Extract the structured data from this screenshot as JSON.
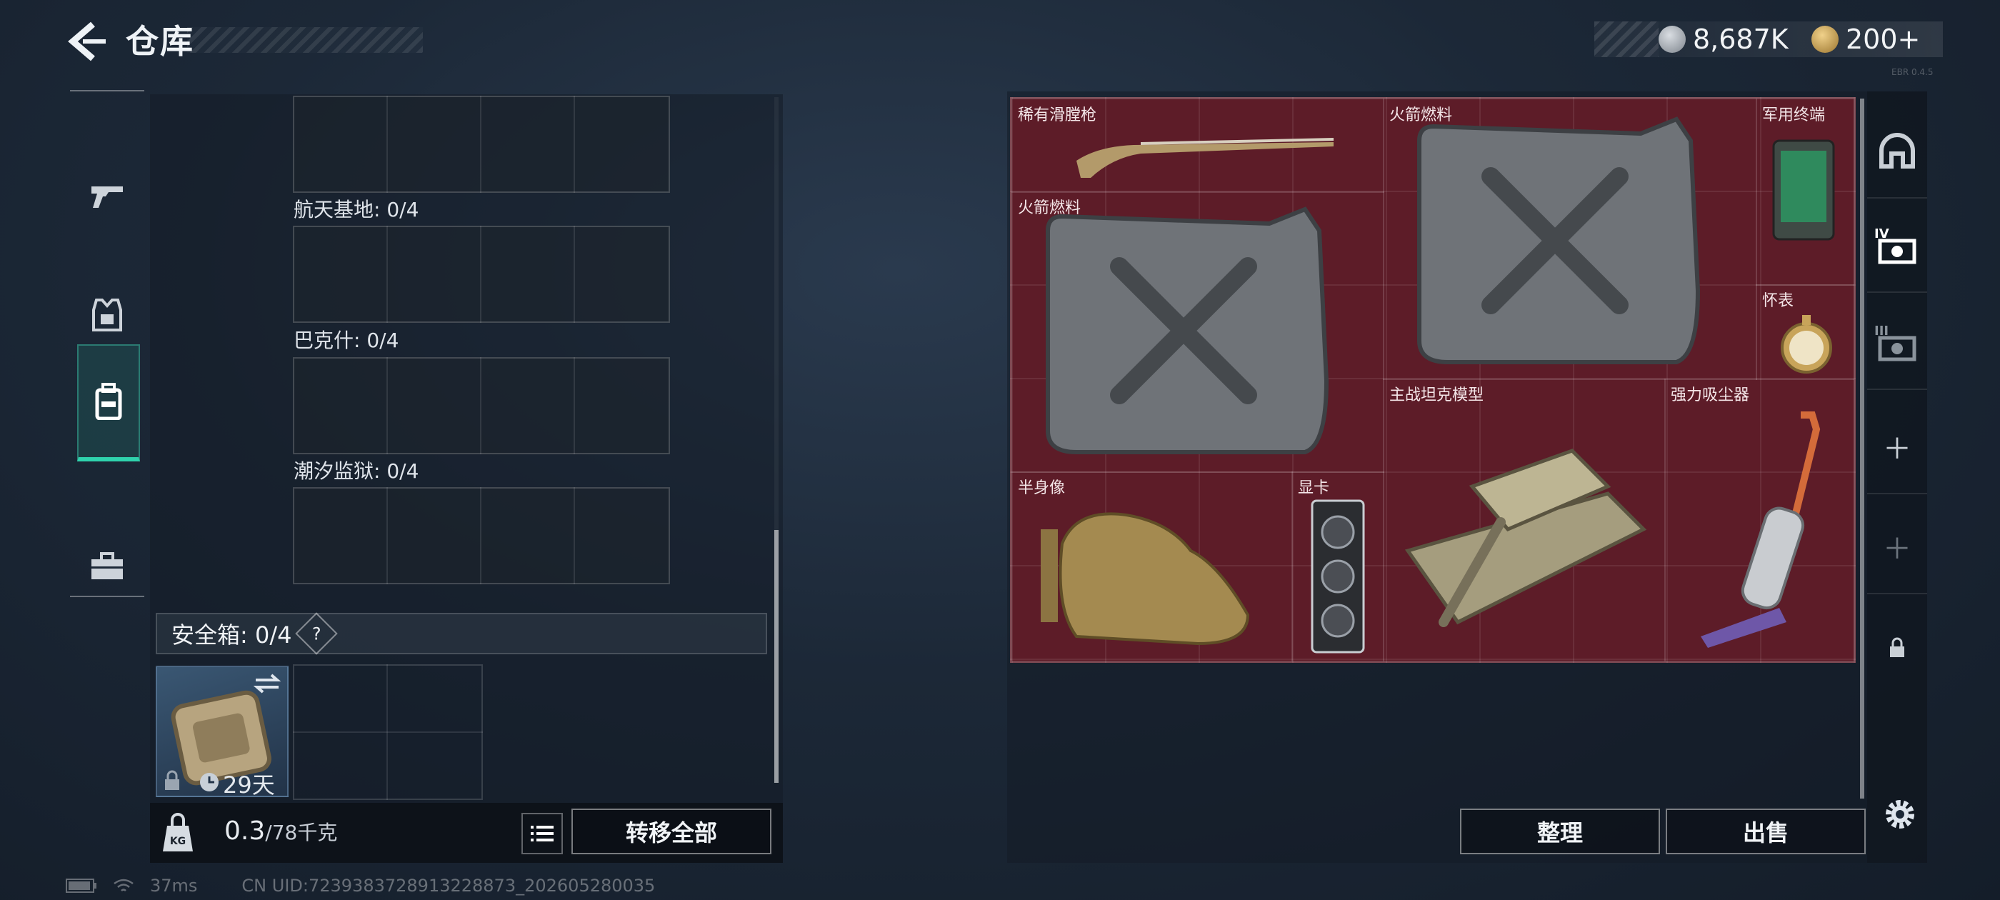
{
  "header": {
    "title": "仓库"
  },
  "currency": {
    "silver": "8,687K",
    "gold": "200+"
  },
  "version_text": "EBR 0.4.5",
  "left_panel": {
    "slots": [
      {
        "label": ""
      },
      {
        "label": "航天基地: 0/4"
      },
      {
        "label": "巴克什: 0/4"
      },
      {
        "label": "潮汐监狱: 0/4"
      }
    ],
    "safe_box": {
      "label": "安全箱: 0/4",
      "help": "?",
      "timer": "29天"
    },
    "weight": {
      "current": "0.3",
      "capacity": "/78千克"
    },
    "transfer_all_label": "转移全部"
  },
  "stash_items": [
    {
      "id": "musket",
      "label": "稀有滑膛枪"
    },
    {
      "id": "fuel1",
      "label": "火箭燃料"
    },
    {
      "id": "terminal",
      "label": "军用终端"
    },
    {
      "id": "fuel2",
      "label": "火箭燃料"
    },
    {
      "id": "pocketwatch",
      "label": "怀表"
    },
    {
      "id": "tank",
      "label": "主战坦克模型"
    },
    {
      "id": "vacuum",
      "label": "强力吸尘器"
    },
    {
      "id": "bust",
      "label": "半身像"
    },
    {
      "id": "gpu",
      "label": "显卡"
    }
  ],
  "right_panel": {
    "sort_label": "整理",
    "sell_label": "出售"
  },
  "status_bar": {
    "ping": "37ms",
    "uid": "CN UID:7239383728913228873_202605280035"
  },
  "icons": {
    "nav": [
      "gun-icon",
      "vest-icon",
      "backpack-icon",
      "toolbox-icon"
    ],
    "rail": [
      "helmet-icon",
      "case-4-icon",
      "case-3-icon",
      "plus-icon",
      "plus-icon",
      "lock-icon"
    ]
  },
  "colors": {
    "accent": "#2fd3ad",
    "stash_bg": "#5d1c28"
  }
}
